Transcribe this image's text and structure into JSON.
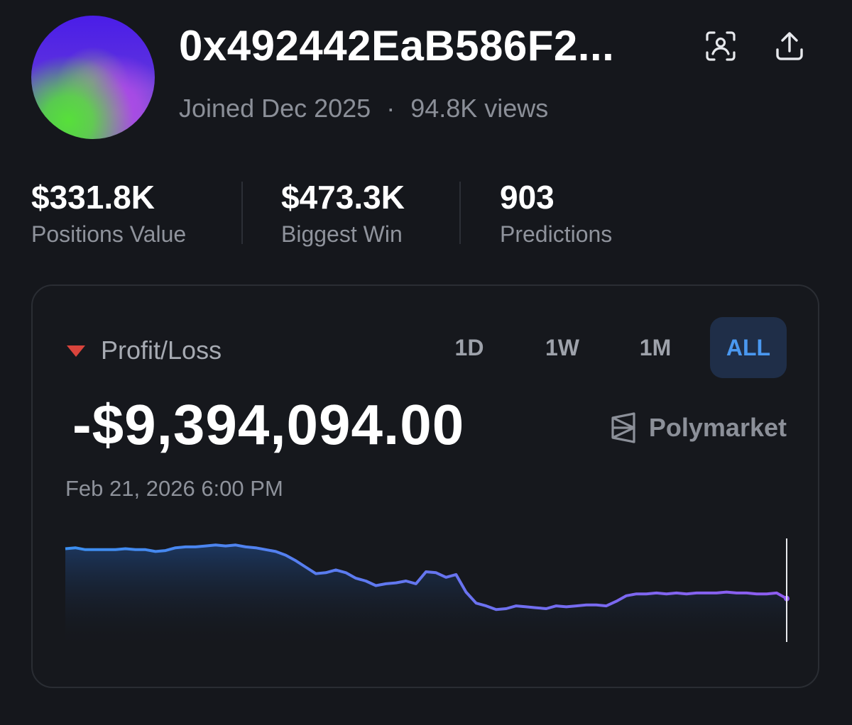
{
  "profile": {
    "address": "0x492442EaB586F2...",
    "joined": "Joined Dec 2025",
    "separator": "·",
    "views": "94.8K views",
    "avatar_colors": [
      "#4a1de8",
      "#57e03a",
      "#b44be8"
    ]
  },
  "actions": [
    {
      "name": "scan-profile-icon"
    },
    {
      "name": "share-icon"
    }
  ],
  "stats": [
    {
      "value": "$331.8K",
      "label": "Positions Value"
    },
    {
      "value": "$473.3K",
      "label": "Biggest Win"
    },
    {
      "value": "903",
      "label": "Predictions"
    }
  ],
  "pnl_card": {
    "label": "Profit/Loss",
    "direction_icon": "down-triangle-icon",
    "value": "-$9,394,094.00",
    "timestamp": "Feb 21, 2026 6:00 PM",
    "brand": "Polymarket",
    "tabs": [
      "1D",
      "1W",
      "1M",
      "ALL"
    ],
    "active_tab": "ALL",
    "colors": {
      "negative": "#d9443c",
      "active_tab": "#4a98f0",
      "line_start": "#3b8ff0",
      "line_end": "#8f5cf0"
    }
  },
  "chart_data": {
    "type": "area",
    "title": "",
    "xlabel": "",
    "ylabel": "",
    "grid": false,
    "axes_visible": false,
    "values": [
      0.95,
      0.96,
      0.94,
      0.94,
      0.94,
      0.94,
      0.95,
      0.94,
      0.94,
      0.92,
      0.93,
      0.96,
      0.97,
      0.97,
      0.98,
      0.99,
      0.98,
      0.99,
      0.97,
      0.96,
      0.94,
      0.92,
      0.88,
      0.82,
      0.75,
      0.68,
      0.69,
      0.72,
      0.69,
      0.63,
      0.6,
      0.55,
      0.57,
      0.58,
      0.6,
      0.57,
      0.7,
      0.69,
      0.64,
      0.67,
      0.48,
      0.36,
      0.33,
      0.29,
      0.3,
      0.33,
      0.32,
      0.31,
      0.3,
      0.33,
      0.32,
      0.33,
      0.34,
      0.34,
      0.33,
      0.38,
      0.44,
      0.46,
      0.46,
      0.47,
      0.46,
      0.47,
      0.46,
      0.47,
      0.47,
      0.47,
      0.48,
      0.47,
      0.47,
      0.46,
      0.46,
      0.47,
      0.41
    ]
  }
}
